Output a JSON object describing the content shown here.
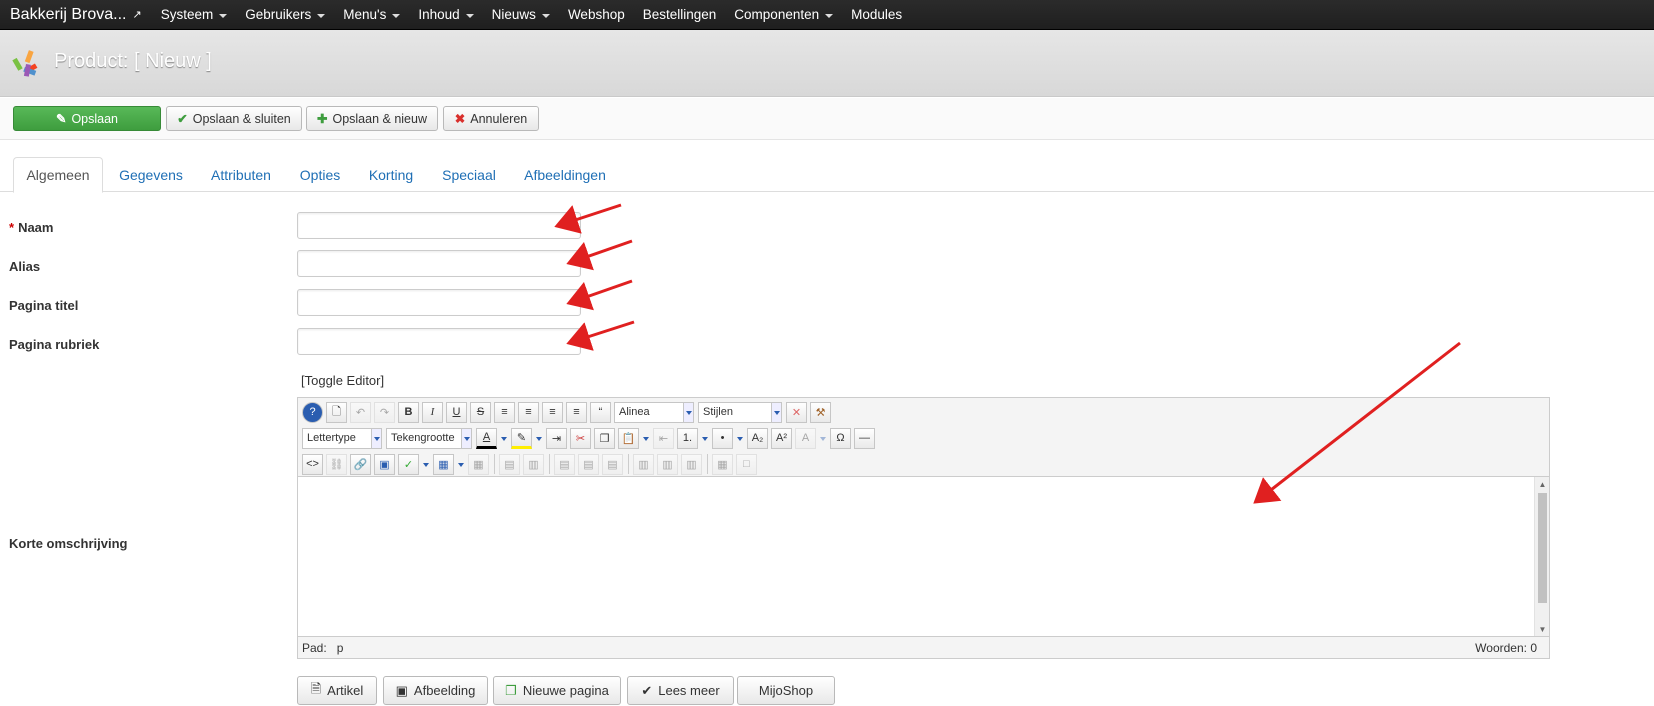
{
  "navbar": {
    "brand": "Bakkerij Brova...",
    "items": [
      {
        "label": "Systeem",
        "dropdown": true
      },
      {
        "label": "Gebruikers",
        "dropdown": true
      },
      {
        "label": "Menu's",
        "dropdown": true
      },
      {
        "label": "Inhoud",
        "dropdown": true
      },
      {
        "label": "Nieuws",
        "dropdown": true
      },
      {
        "label": "Webshop",
        "dropdown": false
      },
      {
        "label": "Bestellingen",
        "dropdown": false
      },
      {
        "label": "Componenten",
        "dropdown": true
      },
      {
        "label": "Modules",
        "dropdown": false
      }
    ]
  },
  "header": {
    "title": "Product: [ Nieuw ]"
  },
  "toolbar": {
    "save": "Opslaan",
    "save_close": "Opslaan & sluiten",
    "save_new": "Opslaan & nieuw",
    "cancel": "Annuleren"
  },
  "tabs": [
    "Algemeen",
    "Gegevens",
    "Attributen",
    "Opties",
    "Korting",
    "Speciaal",
    "Afbeeldingen"
  ],
  "form": {
    "naam_required": "*",
    "naam": "Naam",
    "alias": "Alias",
    "pagina_titel": "Pagina titel",
    "pagina_rubriek": "Pagina rubriek",
    "korte_omschrijving": "Korte omschrijving"
  },
  "editor": {
    "toggle": "[Toggle Editor]",
    "format_select": "Alinea",
    "styles_select": "Stijlen",
    "font_select": "Lettertype",
    "size_select": "Tekengrootte",
    "path_label": "Pad:",
    "path_value": "p",
    "word_count": "Woorden: 0"
  },
  "bottom_buttons": {
    "artikel": "Artikel",
    "afbeelding": "Afbeelding",
    "nieuwe_pagina": "Nieuwe pagina",
    "lees_meer": "Lees meer",
    "mijoshop": "MijoShop"
  },
  "colors": {
    "navbar": "#222222",
    "primary": "#46a546",
    "link": "#1f6fb5",
    "arrow": "#e02020"
  }
}
